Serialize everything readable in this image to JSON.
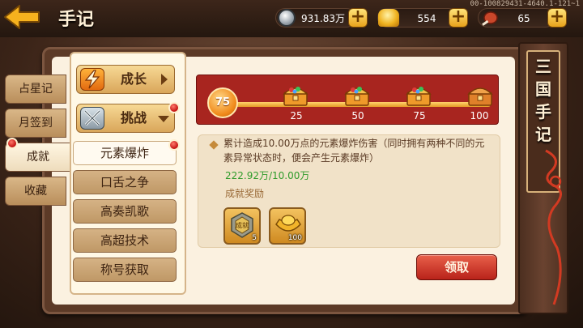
{
  "header": {
    "title": "手记",
    "build_id": "00-100829431-4640.1-121~1"
  },
  "resources": [
    {
      "name": "silver",
      "icon": "silver-coin-icon",
      "value": "931.83万"
    },
    {
      "name": "gold",
      "icon": "gold-ingot-icon",
      "value": "554"
    },
    {
      "name": "stamina",
      "icon": "meat-icon",
      "value": "65"
    }
  ],
  "side_tabs": [
    "占星记",
    "月签到",
    "成就",
    "收藏"
  ],
  "categories": {
    "growth": "成长",
    "challenge": "挑战"
  },
  "sub_items": [
    "元素爆炸",
    "口舌之争",
    "高奏凯歌",
    "高超技术",
    "称号获取"
  ],
  "progress": {
    "current": "75",
    "milestones": [
      "25",
      "50",
      "75",
      "100"
    ]
  },
  "achievement": {
    "description": "累计造成10.00万点的元素爆炸伤害（同时拥有两种不同的元素异常状态时，便会产生元素爆炸）",
    "progress_text": "222.92万/10.00万",
    "reward_title": "成就奖励",
    "rewards": [
      {
        "icon": "achievement-badge-icon",
        "badge_text": "成就",
        "qty": "5"
      },
      {
        "icon": "gold-ingot-icon",
        "qty": "100"
      }
    ]
  },
  "claim_label": "领取",
  "banner_title": [
    "三",
    "国",
    "手",
    "记"
  ],
  "colors": {
    "accent": "#a8251f",
    "gold": "#e8a21b",
    "progress_green": "#2e9b2a"
  }
}
